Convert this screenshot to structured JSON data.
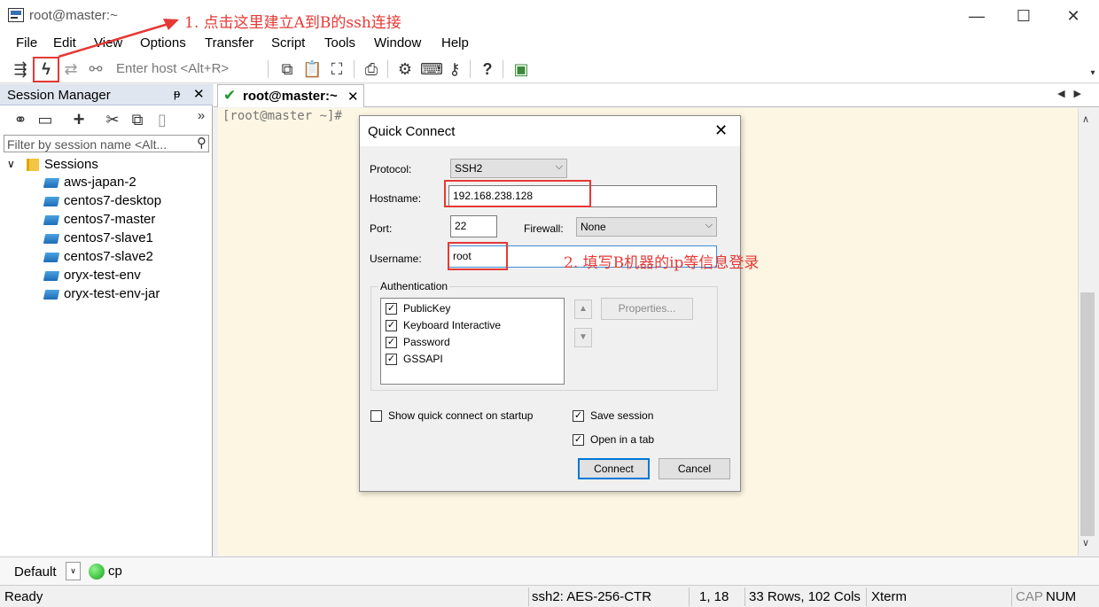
{
  "window": {
    "title": "root@master:~",
    "minimize": "—",
    "maximize": "☐",
    "close": "✕"
  },
  "menu": [
    "File",
    "Edit",
    "View",
    "Options",
    "Transfer",
    "Script",
    "Tools",
    "Window",
    "Help"
  ],
  "toolbar": {
    "enter_host": "Enter host <Alt+R>"
  },
  "session_manager": {
    "title": "Session Manager",
    "pin": "ᵽ",
    "close": "✕",
    "more": "»",
    "filter_placeholder": "Filter by session name <Alt...",
    "root": "Sessions",
    "sessions": [
      "aws-japan-2",
      "centos7-desktop",
      "centos7-master",
      "centos7-slave1",
      "centos7-slave2",
      "oryx-test-env",
      "oryx-test-env-jar"
    ]
  },
  "tab": {
    "label": "root@master:~",
    "close": "✕",
    "arrows": "◀▶"
  },
  "terminal": {
    "prompt": "[root@master ~]#"
  },
  "dialog": {
    "title": "Quick Connect",
    "close": "✕",
    "protocol_label": "Protocol:",
    "protocol_value": "SSH2",
    "hostname_label": "Hostname:",
    "hostname_value": "192.168.238.128",
    "port_label": "Port:",
    "port_value": "22",
    "firewall_label": "Firewall:",
    "firewall_value": "None",
    "username_label": "Username:",
    "username_value": "root",
    "auth_title": "Authentication",
    "auth_methods": [
      "PublicKey",
      "Keyboard Interactive",
      "Password",
      "GSSAPI"
    ],
    "properties": "Properties...",
    "show_on_startup": "Show quick connect on startup",
    "save_session": "Save session",
    "open_in_tab": "Open in a tab",
    "connect": "Connect",
    "cancel": "Cancel"
  },
  "session_bar": {
    "default": "Default",
    "cp": "cp"
  },
  "status": {
    "ready": "Ready",
    "cipher": "ssh2: AES-256-CTR",
    "position": "1, 18",
    "size": "33 Rows, 102 Cols",
    "terminal": "Xterm",
    "cap": "CAP",
    "num": "NUM"
  },
  "annotations": {
    "step1": "1. 点击这里建立A到B的ssh连接",
    "step2": "2. 填写B机器的ip等信息登录"
  },
  "colors": {
    "annotation": "#e53935",
    "terminal_bg": "#fdf6e3",
    "connected": "#1a9a2a"
  }
}
